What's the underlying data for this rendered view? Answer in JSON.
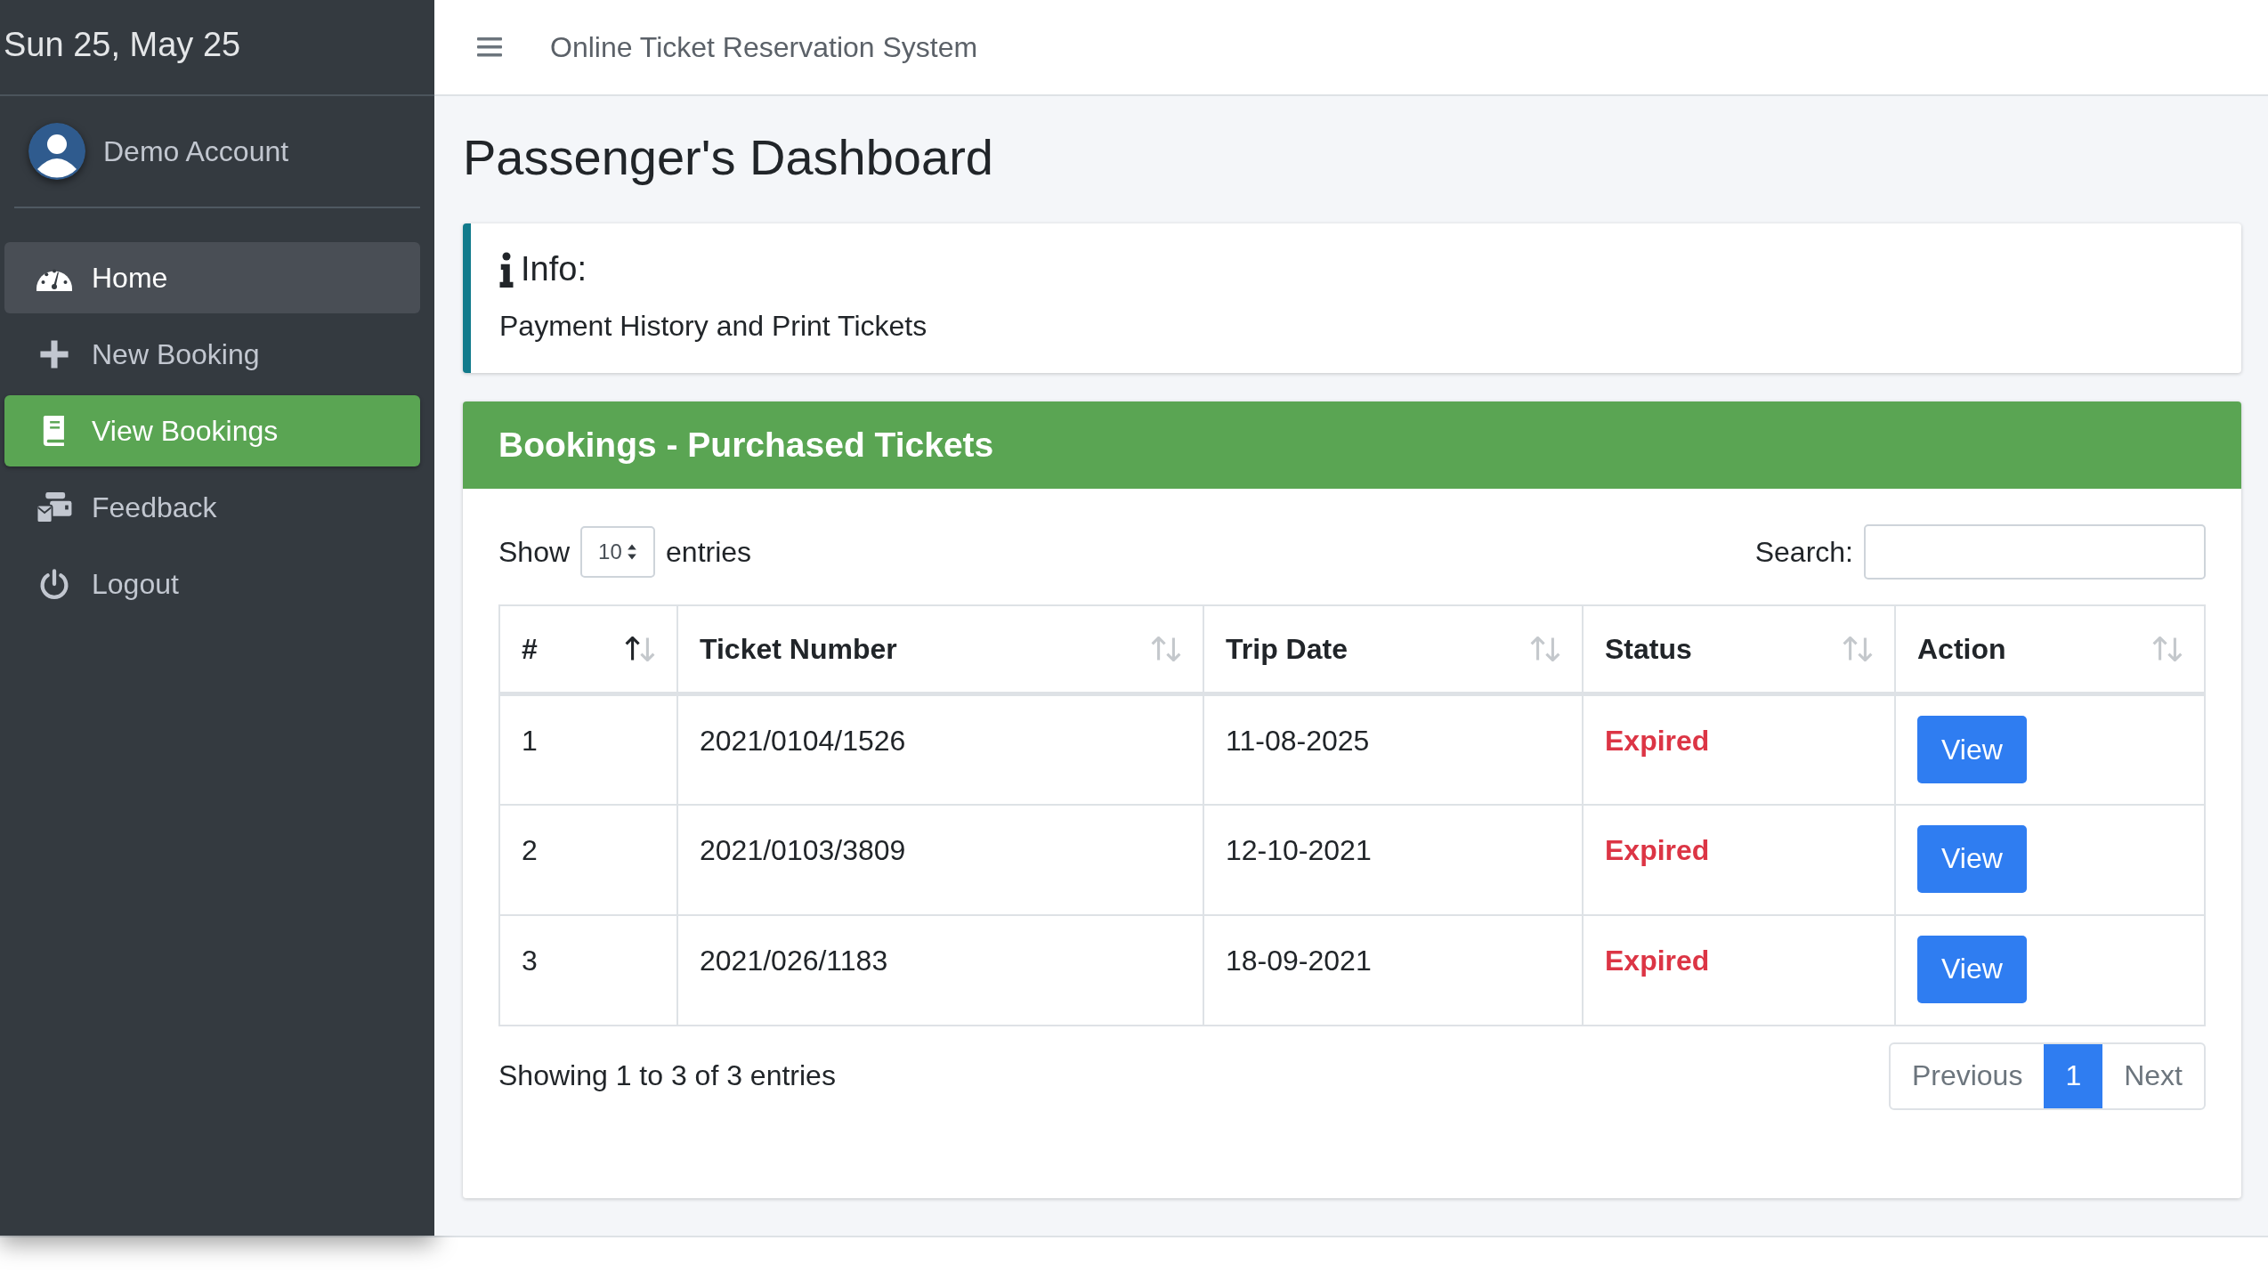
{
  "sidebar": {
    "date": "Sun 25, May 25",
    "user": "Demo Account",
    "items": [
      {
        "label": "Home",
        "kind": "gauge",
        "highlighted": true,
        "selected": false
      },
      {
        "label": "New Booking",
        "kind": "plus",
        "highlighted": false,
        "selected": false
      },
      {
        "label": "View Bookings",
        "kind": "book",
        "highlighted": false,
        "selected": true
      },
      {
        "label": "Feedback",
        "kind": "feedback",
        "highlighted": false,
        "selected": false
      },
      {
        "label": "Logout",
        "kind": "power",
        "highlighted": false,
        "selected": false
      }
    ]
  },
  "header": {
    "title": "Online Ticket Reservation System"
  },
  "page_title": "Passenger's Dashboard",
  "info": {
    "title": "Info:",
    "text": "Payment History and Print Tickets"
  },
  "card": {
    "title": "Bookings - Purchased Tickets",
    "length": {
      "before": "Show",
      "value": "10",
      "after": "entries"
    },
    "search": {
      "label": "Search:"
    },
    "columns": [
      {
        "label": "#",
        "sorted_ascending": true
      },
      {
        "label": "Ticket Number",
        "sorted_ascending": false
      },
      {
        "label": "Trip Date",
        "sorted_ascending": false
      },
      {
        "label": "Status",
        "sorted_ascending": false
      },
      {
        "label": "Action",
        "sorted_ascending": false
      }
    ],
    "rows": [
      {
        "number": "1",
        "ticket": "2021/0104/1526",
        "date": "11-08-2025",
        "status": "Expired",
        "action": "View"
      },
      {
        "number": "2",
        "ticket": "2021/0103/3809",
        "date": "12-10-2021",
        "status": "Expired",
        "action": "View"
      },
      {
        "number": "3",
        "ticket": "2021/026/1183",
        "date": "18-09-2021",
        "status": "Expired",
        "action": "View"
      }
    ],
    "info_text": "Showing 1 to 3 of 3 entries",
    "pagination": [
      {
        "label": "Previous",
        "selected": false
      },
      {
        "label": "1",
        "selected": true
      },
      {
        "label": "Next",
        "selected": false
      }
    ]
  }
}
